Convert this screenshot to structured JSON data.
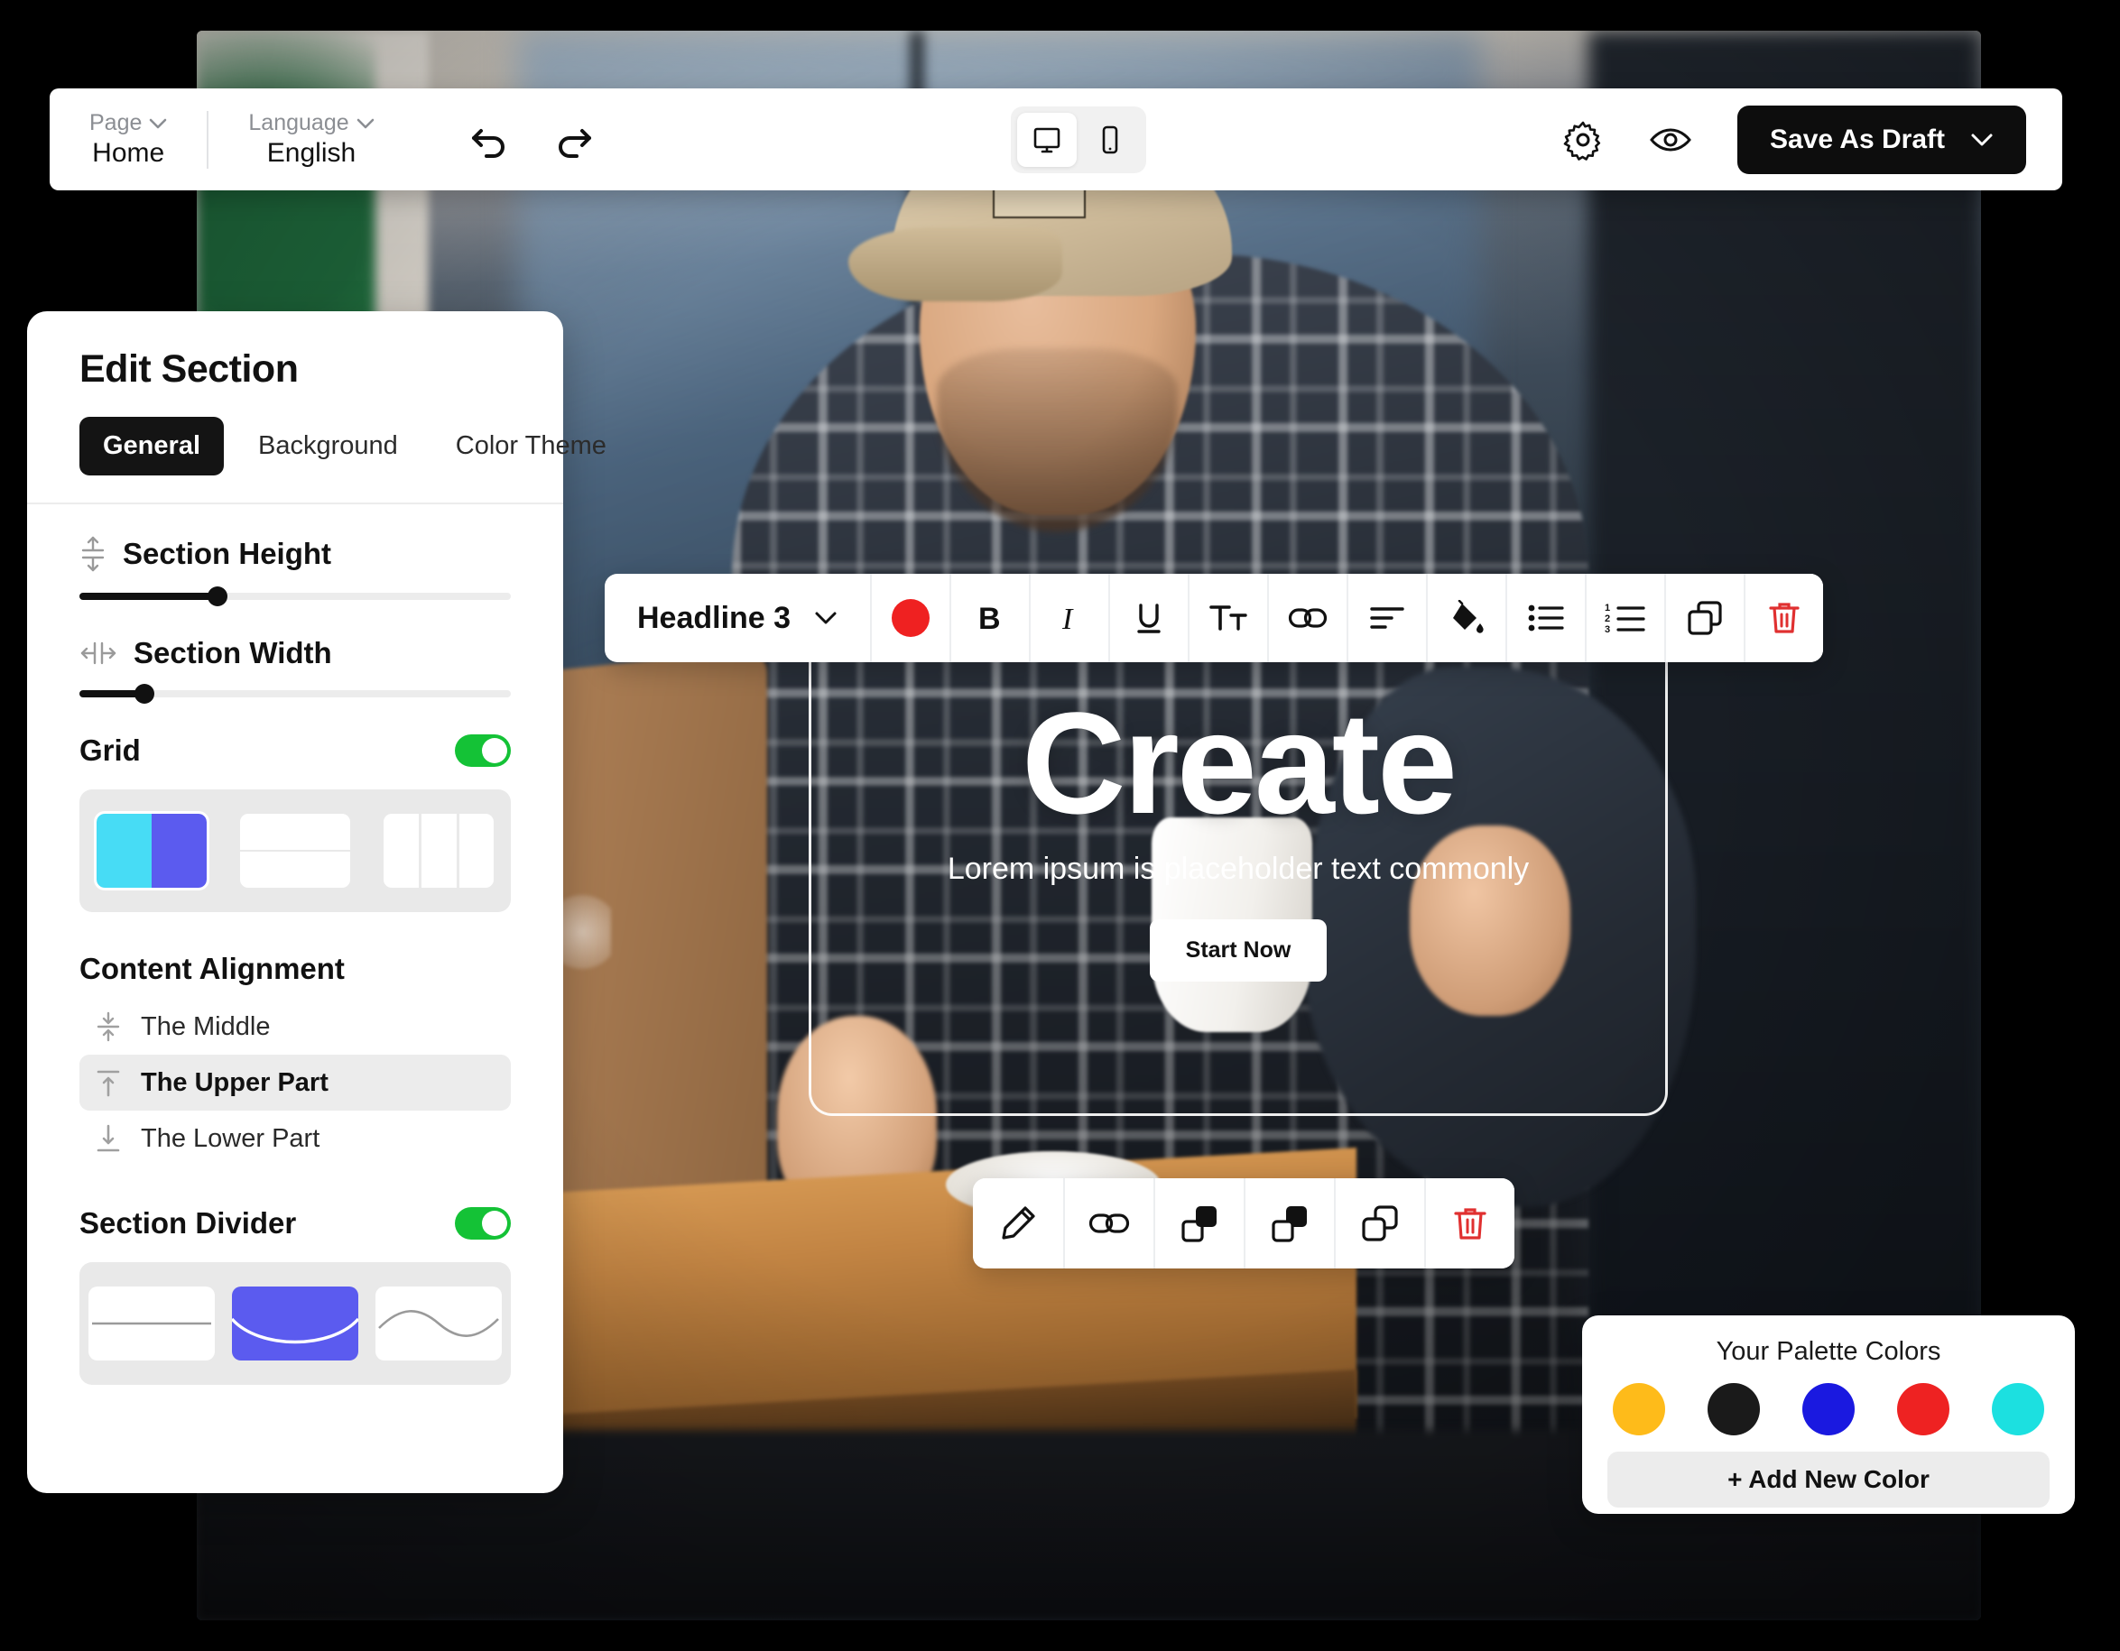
{
  "topbar": {
    "page": {
      "label": "Page",
      "value": "Home",
      "caret_icon": "chevron-down-icon"
    },
    "language": {
      "label": "Language",
      "value": "English",
      "caret_icon": "chevron-down-icon"
    },
    "undo_icon": "undo-icon",
    "redo_icon": "redo-icon",
    "devices": [
      {
        "name": "desktop",
        "icon": "desktop-icon",
        "active": true
      },
      {
        "name": "mobile",
        "icon": "mobile-icon",
        "active": false
      }
    ],
    "settings_icon": "gear-icon",
    "preview_icon": "eye-icon",
    "save": {
      "label": "Save As Draft",
      "caret_icon": "chevron-down-icon"
    }
  },
  "panel": {
    "title": "Edit Section",
    "tabs": [
      {
        "label": "General",
        "active": true
      },
      {
        "label": "Background",
        "active": false
      },
      {
        "label": "Color Theme",
        "active": false
      }
    ],
    "section_height": {
      "label": "Section Height",
      "icon": "height-arrows-icon",
      "value_pct": 32
    },
    "section_width": {
      "label": "Section Width",
      "icon": "width-arrows-icon",
      "value_pct": 15
    },
    "grid": {
      "label": "Grid",
      "enabled": true,
      "options": [
        {
          "name": "two-columns-colored",
          "selected": true
        },
        {
          "name": "two-rows",
          "selected": false
        },
        {
          "name": "three-columns",
          "selected": false
        }
      ]
    },
    "content_alignment": {
      "label": "Content Alignment",
      "items": [
        {
          "label": "The Middle",
          "icon": "align-middle-icon",
          "selected": false
        },
        {
          "label": "The Upper Part",
          "icon": "align-top-icon",
          "selected": true
        },
        {
          "label": "The Lower Part",
          "icon": "align-bottom-icon",
          "selected": false
        }
      ]
    },
    "section_divider": {
      "label": "Section Divider",
      "enabled": true,
      "options": [
        {
          "name": "straight-line",
          "selected": false
        },
        {
          "name": "curve",
          "selected": true
        },
        {
          "name": "wave",
          "selected": false
        }
      ]
    }
  },
  "format_toolbar": {
    "style": {
      "label": "Headline 3",
      "caret_icon": "chevron-down-icon"
    },
    "color_swatch": "#ef2121",
    "buttons": [
      {
        "name": "text-color-button",
        "icon": "color-circle-icon"
      },
      {
        "name": "bold-button",
        "icon": "bold-icon",
        "label": "B"
      },
      {
        "name": "italic-button",
        "icon": "italic-icon",
        "label": "I"
      },
      {
        "name": "underline-button",
        "icon": "underline-icon",
        "label": "U"
      },
      {
        "name": "font-size-button",
        "icon": "text-size-icon"
      },
      {
        "name": "link-button",
        "icon": "link-icon"
      },
      {
        "name": "align-button",
        "icon": "align-left-icon"
      },
      {
        "name": "fill-color-button",
        "icon": "paint-bucket-icon"
      },
      {
        "name": "bullet-list-button",
        "icon": "bullet-list-icon"
      },
      {
        "name": "numbered-list-button",
        "icon": "numbered-list-icon"
      },
      {
        "name": "duplicate-button",
        "icon": "duplicate-icon"
      },
      {
        "name": "delete-button",
        "icon": "trash-icon"
      }
    ]
  },
  "element_toolbar": {
    "buttons": [
      {
        "name": "edit-button",
        "icon": "pencil-icon"
      },
      {
        "name": "link-button",
        "icon": "link-icon"
      },
      {
        "name": "bring-forward-button",
        "icon": "bring-forward-icon"
      },
      {
        "name": "send-backward-button",
        "icon": "send-backward-icon"
      },
      {
        "name": "duplicate-button",
        "icon": "duplicate-icon"
      },
      {
        "name": "delete-button",
        "icon": "trash-icon"
      }
    ]
  },
  "palette": {
    "title": "Your Palette Colors",
    "colors": [
      "#febb1a",
      "#1a1a1a",
      "#1a19e0",
      "#ee2222",
      "#1ce0e0"
    ],
    "add_label": "+ Add New Color"
  },
  "hero": {
    "title": "Create",
    "subtitle": "Lorem ipsum is placeholder text commonly",
    "cta": "Start Now"
  }
}
